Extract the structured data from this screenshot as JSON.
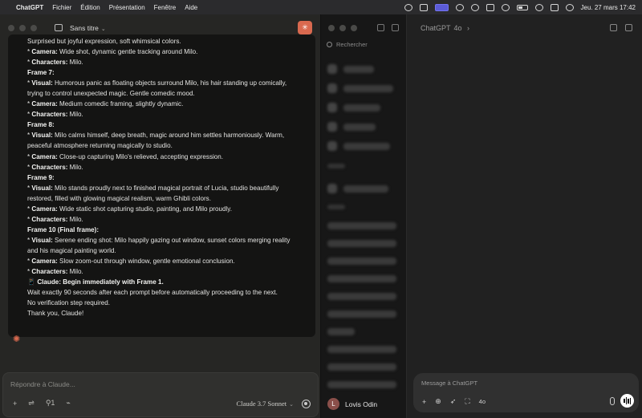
{
  "menubar": {
    "app": "ChatGPT",
    "items": [
      "Fichier",
      "Édition",
      "Présentation",
      "Fenêtre",
      "Aide"
    ],
    "datetime": "Jeu. 27 mars  17:42"
  },
  "claude": {
    "chat_title": "Sans titre",
    "lines": [
      {
        "text": "Surprised but joyful expression, soft whimsical colors."
      },
      {
        "bullet": true,
        "label": "Camera:",
        "text": " Wide shot, dynamic gentle tracking around Milo."
      },
      {
        "bullet": true,
        "label": "Characters:",
        "text": " Milo."
      },
      {
        "heading": "Frame 7:"
      },
      {
        "bullet": true,
        "label": "Visual:",
        "text": " Humorous panic as floating objects surround Milo, his hair standing up comically,"
      },
      {
        "text": "trying to control unexpected magic. Gentle comedic mood."
      },
      {
        "bullet": true,
        "label": "Camera:",
        "text": " Medium comedic framing, slightly dynamic."
      },
      {
        "bullet": true,
        "label": "Characters:",
        "text": " Milo."
      },
      {
        "heading": "Frame 8:"
      },
      {
        "bullet": true,
        "label": "Visual:",
        "text": " Milo calms himself, deep breath, magic around him settles harmoniously. Warm,"
      },
      {
        "text": "peaceful atmosphere returning magically to studio."
      },
      {
        "bullet": true,
        "label": "Camera:",
        "text": " Close-up capturing Milo's relieved, accepting expression."
      },
      {
        "bullet": true,
        "label": "Characters:",
        "text": " Milo."
      },
      {
        "heading": "Frame 9:"
      },
      {
        "bullet": true,
        "label": "Visual:",
        "text": " Milo stands proudly next to finished magical portrait of Lucia, studio beautifully"
      },
      {
        "text": "restored, filled with glowing magical realism, warm Ghibli colors."
      },
      {
        "bullet": true,
        "label": "Camera:",
        "text": " Wide static shot capturing studio, painting, and Milo proudly."
      },
      {
        "bullet": true,
        "label": "Characters:",
        "text": " Milo."
      },
      {
        "heading": "Frame 10 (Final frame):"
      },
      {
        "bullet": true,
        "label": "Visual:",
        "text": " Serene ending shot: Milo happily gazing out window, sunset colors merging reality"
      },
      {
        "text": "and his magical painting world."
      },
      {
        "bullet": true,
        "label": "Camera:",
        "text": " Slow zoom-out through window, gentle emotional conclusion."
      },
      {
        "bullet": true,
        "label": "Characters:",
        "text": " Milo."
      },
      {
        "icon": "📱",
        "label": "Claude: Begin immediately with Frame 1."
      },
      {
        "text": "Wait exactly 90 seconds after each prompt before automatically proceeding to the next."
      },
      {
        "text": "No verification step required."
      },
      {
        "text": "Thank you, Claude!"
      }
    ],
    "input_placeholder": "Répondre à Claude...",
    "model": "Claude 3.7 Sonnet",
    "tools_count": "1"
  },
  "chatgpt": {
    "search_placeholder": "Rechercher",
    "header_model": "ChatGPT",
    "header_version": "4o",
    "user_initial": "L",
    "user_name": "Lovis Odin",
    "composer_placeholder": "Message à ChatGPT",
    "composer_model": "4o"
  }
}
